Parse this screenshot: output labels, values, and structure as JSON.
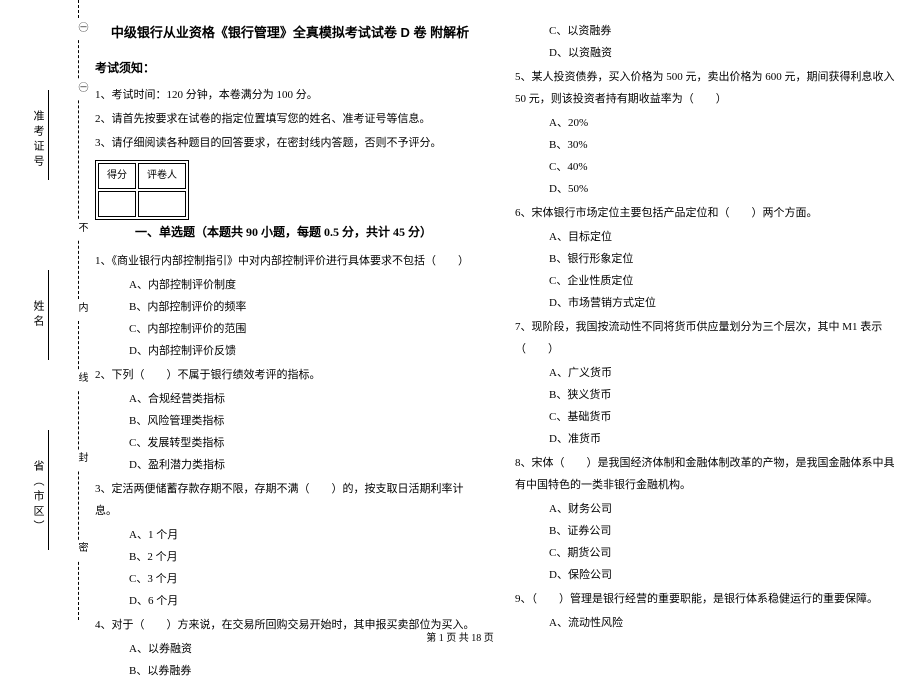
{
  "binding": {
    "chars": [
      "㊀",
      "密",
      "封",
      "线",
      "内",
      "不",
      "㊀"
    ],
    "fields": [
      {
        "label": "准考证号"
      },
      {
        "label": "姓名"
      },
      {
        "label": "省（市区）"
      }
    ]
  },
  "title": "中级银行从业资格《银行管理》全真模拟考试试卷 D 卷  附解析",
  "notice_heading": "考试须知：",
  "notices": [
    "1、考试时间：120 分钟，本卷满分为 100 分。",
    "2、请首先按要求在试卷的指定位置填写您的姓名、准考证号等信息。",
    "3、请仔细阅读各种题目的回答要求，在密封线内答题，否则不予评分。"
  ],
  "scorebox": {
    "h1": "得分",
    "h2": "评卷人"
  },
  "section1": "一、单选题（本题共 90 小题，每题 0.5 分，共计 45 分）",
  "left_questions": [
    {
      "stem": "1、《商业银行内部控制指引》中对内部控制评价进行具体要求不包括（　　）",
      "opts": [
        "A、内部控制评价制度",
        "B、内部控制评价的频率",
        "C、内部控制评价的范围",
        "D、内部控制评价反馈"
      ]
    },
    {
      "stem": "2、下列（　　）不属于银行绩效考评的指标。",
      "opts": [
        "A、合规经营类指标",
        "B、风险管理类指标",
        "C、发展转型类指标",
        "D、盈利潜力类指标"
      ]
    },
    {
      "stem": "3、定活两便储蓄存款存期不限，存期不满（　　）的，按支取日活期利率计息。",
      "opts": [
        "A、1 个月",
        "B、2 个月",
        "C、3 个月",
        "D、6 个月"
      ]
    },
    {
      "stem": "4、对于（　　）方来说，在交易所回购交易开始时，其申报买卖部位为买入。",
      "opts": [
        "A、以券融资",
        "B、以券融券"
      ]
    }
  ],
  "right_top_opts": [
    "C、以资融券",
    "D、以资融资"
  ],
  "right_questions": [
    {
      "stem": "5、某人投资债券，买入价格为 500 元，卖出价格为 600 元，期间获得利息收入 50 元，则该投资者持有期收益率为（　　）",
      "opts": [
        "A、20%",
        "B、30%",
        "C、40%",
        "D、50%"
      ]
    },
    {
      "stem": "6、宋体银行市场定位主要包括产品定位和（　　）两个方面。",
      "opts": [
        "A、目标定位",
        "B、银行形象定位",
        "C、企业性质定位",
        "D、市场营销方式定位"
      ]
    },
    {
      "stem": "7、现阶段，我国按流动性不同将货币供应量划分为三个层次，其中 M1 表示（　　）",
      "opts": [
        "A、广义货币",
        "B、狭义货币",
        "C、基础货币",
        "D、准货币"
      ]
    },
    {
      "stem": "8、宋体（　　）是我国经济体制和金融体制改革的产物，是我国金融体系中具有中国特色的一类非银行金融机构。",
      "opts": [
        "A、财务公司",
        "B、证券公司",
        "C、期货公司",
        "D、保险公司"
      ]
    },
    {
      "stem": "9、（　　）管理是银行经营的重要职能，是银行体系稳健运行的重要保障。",
      "opts": [
        "A、流动性风险"
      ]
    }
  ],
  "footer": "第 1 页  共 18 页"
}
